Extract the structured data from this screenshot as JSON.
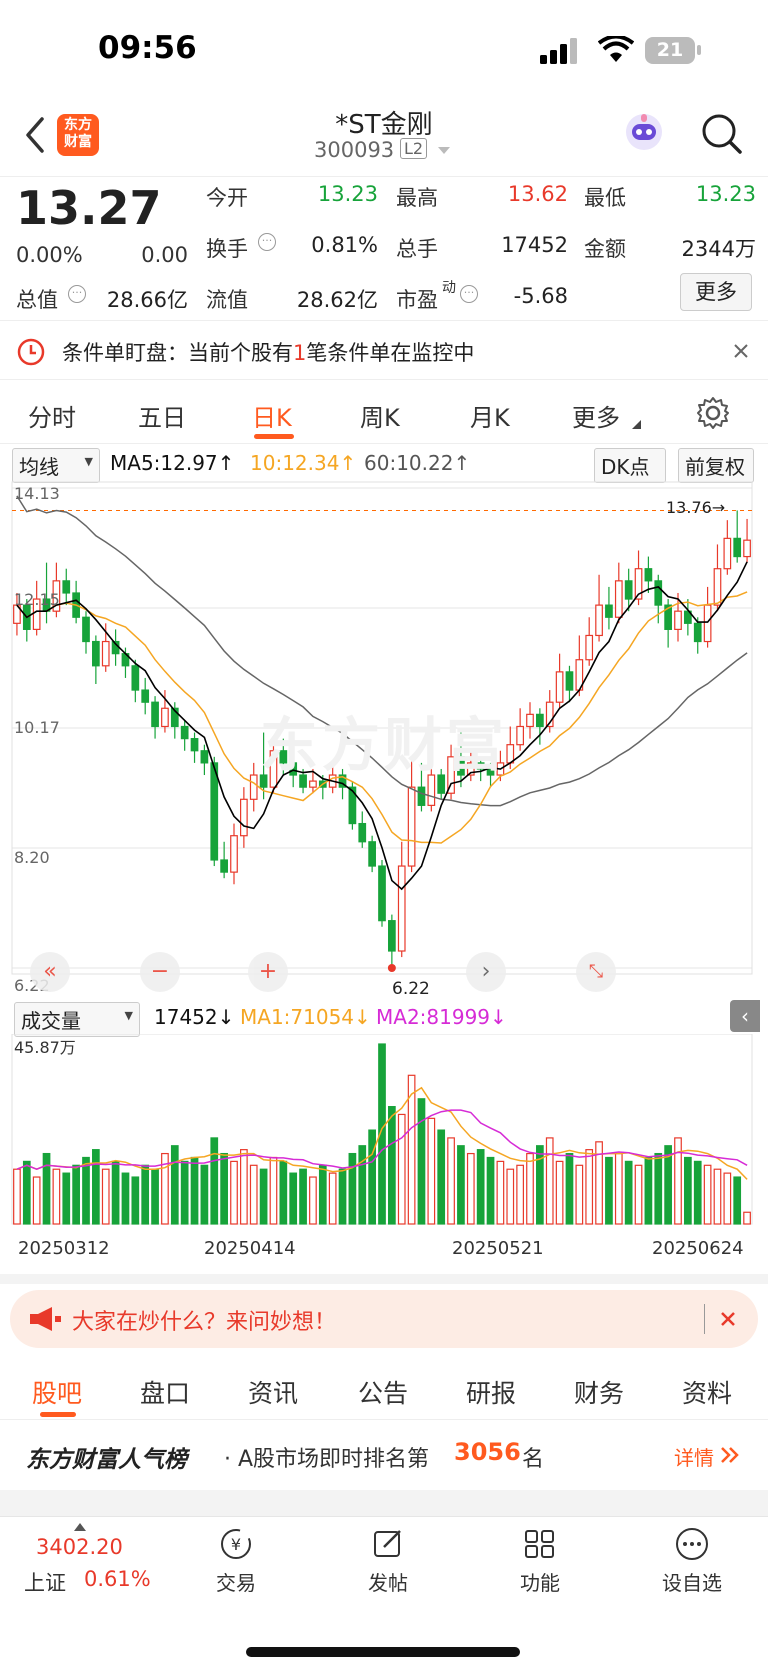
{
  "status": {
    "time": "09:56",
    "battery": "21"
  },
  "header": {
    "title": "*ST金刚",
    "code": "300093",
    "level": "L2",
    "logo": "东方\n财富"
  },
  "quote": {
    "price": "13.27",
    "change_pct": "0.00%",
    "change": "0.00",
    "open_label": "今开",
    "open": "13.23",
    "high_label": "最高",
    "high": "13.62",
    "low_label": "最低",
    "low": "13.23",
    "turnover_label": "换手",
    "turnover": "0.81%",
    "total_hands_label": "总手",
    "total_hands": "17452",
    "amount_label": "金额",
    "amount": "2344万",
    "mcap_label": "总值",
    "mcap": "28.66亿",
    "float_label": "流值",
    "float": "28.62亿",
    "pe_label": "市盈",
    "pe_sup": "动",
    "pe": "-5.68",
    "more": "更多"
  },
  "alert": {
    "prefix": "条件单盯盘：当前个股有",
    "count": "1",
    "suffix": "笔条件单在监控中"
  },
  "tabs": [
    "分时",
    "五日",
    "日K",
    "周K",
    "月K",
    "更多"
  ],
  "active_tab": "日K",
  "ma": {
    "selector": "均线",
    "ma5": "MA5:12.97↑",
    "ma10": "10:12.34↑",
    "ma60": "60:10.22↑",
    "dk": "DK点",
    "fq": "前复权"
  },
  "price_axis": [
    "14.13",
    "12.15",
    "10.17",
    "8.20",
    "6.22"
  ],
  "annotations": {
    "high": "13.76→",
    "low": "6.22"
  },
  "watermark": "东方财富",
  "volume": {
    "selector": "成交量",
    "value": "17452↓",
    "ma1": "MA1:71054↓",
    "ma2": "MA2:81999↓",
    "max": "45.87万"
  },
  "dates": [
    "20250312",
    "20250414",
    "20250521",
    "20250624"
  ],
  "banner": "大家在炒什么？来问妙想！",
  "subtabs": [
    "股吧",
    "盘口",
    "资讯",
    "公告",
    "研报",
    "财务",
    "资料"
  ],
  "rank": {
    "title": "东方财富人气榜",
    "text": "· A股市场即时排名第",
    "num": "3056",
    "unit": "名",
    "detail": "详情"
  },
  "bottom": {
    "index_value": "3402.20",
    "index_name": "上证",
    "index_pct": "0.61%",
    "items": [
      "交易",
      "发帖",
      "功能",
      "设自选"
    ]
  },
  "colors": {
    "up": "#e8392a",
    "down": "#17a33a",
    "ma5": "#000000",
    "ma10": "#f5a623",
    "ma60": "#666666",
    "accent": "#ff6a00"
  },
  "chart_data": {
    "type": "candlestick",
    "ylim": [
      6.22,
      14.13
    ],
    "candles": [
      [
        11.9,
        12.2,
        12.4,
        11.7
      ],
      [
        12.2,
        11.8,
        12.3,
        11.6
      ],
      [
        11.8,
        12.3,
        12.6,
        11.7
      ],
      [
        12.3,
        12.1,
        12.9,
        11.9
      ],
      [
        12.1,
        12.6,
        12.9,
        12.0
      ],
      [
        12.6,
        12.4,
        12.8,
        12.2
      ],
      [
        12.4,
        12.0,
        12.6,
        11.9
      ],
      [
        12.0,
        11.6,
        12.1,
        11.4
      ],
      [
        11.6,
        11.2,
        11.7,
        10.9
      ],
      [
        11.2,
        11.6,
        11.9,
        11.1
      ],
      [
        11.6,
        11.4,
        11.8,
        11.2
      ],
      [
        11.4,
        11.2,
        11.5,
        11.0
      ],
      [
        11.2,
        10.8,
        11.3,
        10.6
      ],
      [
        10.8,
        10.6,
        11.0,
        10.4
      ],
      [
        10.6,
        10.2,
        10.7,
        10.0
      ],
      [
        10.2,
        10.5,
        10.8,
        10.1
      ],
      [
        10.5,
        10.2,
        10.6,
        10.0
      ],
      [
        10.2,
        10.0,
        10.3,
        9.8
      ],
      [
        10.0,
        9.8,
        10.1,
        9.6
      ],
      [
        9.8,
        9.6,
        9.9,
        9.4
      ],
      [
        9.6,
        8.0,
        9.7,
        7.9
      ],
      [
        8.0,
        7.8,
        8.3,
        7.7
      ],
      [
        7.8,
        8.4,
        8.6,
        7.6
      ],
      [
        8.4,
        9.0,
        9.2,
        8.2
      ],
      [
        9.0,
        9.4,
        9.6,
        8.8
      ],
      [
        9.4,
        9.2,
        10.1,
        9.0
      ],
      [
        9.2,
        9.8,
        10.0,
        9.1
      ],
      [
        9.8,
        9.6,
        10.0,
        9.4
      ],
      [
        9.6,
        9.4,
        9.7,
        9.2
      ],
      [
        9.4,
        9.2,
        9.5,
        9.1
      ],
      [
        9.2,
        9.3,
        9.5,
        9.1
      ],
      [
        9.3,
        9.2,
        9.4,
        9.0
      ],
      [
        9.2,
        9.4,
        9.6,
        9.1
      ],
      [
        9.4,
        9.2,
        9.5,
        9.0
      ],
      [
        9.2,
        8.6,
        9.3,
        8.5
      ],
      [
        8.6,
        8.3,
        8.8,
        8.2
      ],
      [
        8.3,
        7.9,
        8.4,
        7.8
      ],
      [
        7.9,
        7.0,
        8.0,
        6.9
      ],
      [
        7.0,
        6.5,
        7.1,
        6.22
      ],
      [
        6.5,
        7.9,
        8.3,
        6.4
      ],
      [
        7.9,
        9.2,
        9.7,
        7.8
      ],
      [
        9.2,
        8.9,
        9.6,
        8.8
      ],
      [
        8.9,
        9.4,
        9.7,
        8.8
      ],
      [
        9.4,
        9.1,
        9.5,
        9.0
      ],
      [
        9.1,
        9.7,
        9.9,
        9.0
      ],
      [
        9.7,
        9.4,
        10.1,
        9.2
      ],
      [
        9.4,
        9.6,
        9.8,
        9.3
      ],
      [
        9.6,
        9.5,
        9.7,
        9.3
      ],
      [
        9.5,
        9.4,
        9.6,
        9.2
      ],
      [
        9.4,
        9.6,
        9.8,
        9.3
      ],
      [
        9.6,
        9.9,
        10.2,
        9.5
      ],
      [
        9.9,
        10.2,
        10.5,
        9.8
      ],
      [
        10.2,
        10.4,
        10.6,
        10.0
      ],
      [
        10.4,
        10.2,
        10.5,
        9.9
      ],
      [
        10.2,
        10.6,
        10.8,
        10.1
      ],
      [
        10.6,
        11.1,
        11.4,
        10.5
      ],
      [
        11.1,
        10.8,
        11.2,
        10.6
      ],
      [
        10.8,
        11.3,
        11.7,
        10.7
      ],
      [
        11.3,
        11.7,
        12.0,
        11.2
      ],
      [
        11.7,
        12.2,
        12.7,
        11.6
      ],
      [
        12.2,
        12.0,
        12.5,
        11.8
      ],
      [
        12.0,
        12.6,
        12.9,
        11.9
      ],
      [
        12.6,
        12.3,
        12.8,
        12.1
      ],
      [
        12.3,
        12.8,
        13.1,
        12.2
      ],
      [
        12.8,
        12.6,
        13.0,
        12.4
      ],
      [
        12.6,
        12.2,
        12.7,
        11.9
      ],
      [
        12.2,
        11.8,
        12.3,
        11.5
      ],
      [
        11.8,
        12.1,
        12.4,
        11.6
      ],
      [
        12.1,
        11.9,
        12.3,
        11.7
      ],
      [
        11.9,
        11.6,
        12.0,
        11.4
      ],
      [
        11.6,
        12.2,
        12.5,
        11.5
      ],
      [
        12.2,
        12.8,
        13.2,
        12.1
      ],
      [
        12.8,
        13.3,
        13.6,
        12.7
      ],
      [
        13.3,
        13.0,
        13.76,
        12.9
      ],
      [
        13.0,
        13.27,
        13.62,
        12.9
      ]
    ],
    "volume": [
      14,
      16,
      12,
      18,
      14,
      13,
      15,
      17,
      19,
      14,
      16,
      13,
      12,
      15,
      14,
      18,
      20,
      16,
      17,
      15,
      22,
      18,
      16,
      19,
      15,
      14,
      17,
      16,
      13,
      14,
      12,
      15,
      13,
      14,
      18,
      20,
      24,
      46,
      30,
      28,
      38,
      32,
      27,
      24,
      22,
      20,
      18,
      19,
      17,
      16,
      14,
      15,
      18,
      20,
      22,
      16,
      18,
      15,
      19,
      21,
      17,
      18,
      16,
      15,
      17,
      18,
      20,
      22,
      17,
      16,
      15,
      14,
      13,
      12,
      3
    ],
    "ma_note": "MA5, MA10, MA60 overlays"
  }
}
